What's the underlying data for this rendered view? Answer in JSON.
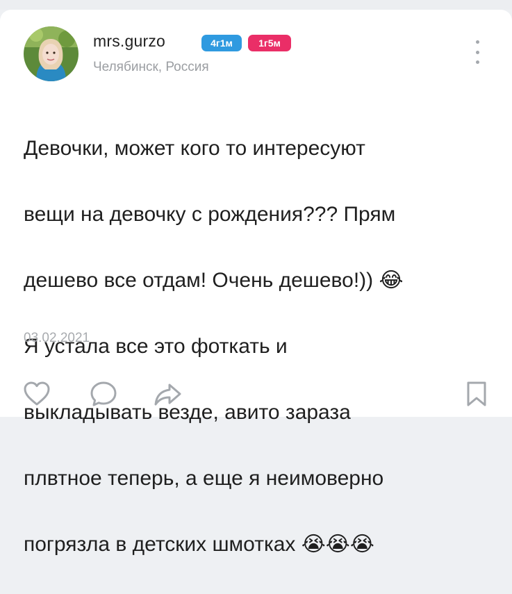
{
  "post": {
    "username": "mrs.gurzo",
    "badges": [
      "4г1м",
      "1г5м"
    ],
    "location": "Челябинск, Россия",
    "text_lines": [
      "Девочки, может кого то интересуют",
      "вещи на девочку с рождения??? Прям",
      "дешево все отдам! Очень дешево!)) 😂",
      "Я устала все это фоткать и",
      "выкладывать везде, авито зараза",
      "плвтное теперь, а еще я неимоверно",
      "погрязла в детских шмотках 😭😭😭"
    ],
    "date": "03.02.2021"
  },
  "actions": {
    "like_icon": "heart-icon",
    "comment_icon": "comment-icon",
    "share_icon": "share-icon",
    "bookmark_icon": "bookmark-icon"
  },
  "colors": {
    "badge_blue": "#2f9ae0",
    "badge_pink": "#ea2e67",
    "icon_gray": "#a4a8ad"
  }
}
